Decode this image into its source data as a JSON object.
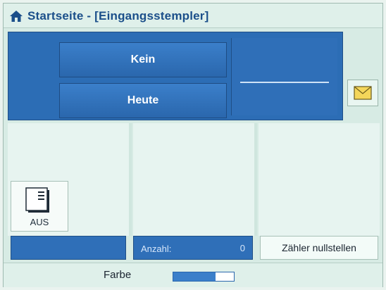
{
  "window": {
    "title": "Startseite - [Eingangsstempler]"
  },
  "panel": {
    "kein_label": "Kein",
    "heute_label": "Heute"
  },
  "aus_button": {
    "label": "AUS"
  },
  "bottom": {
    "anzahl_label": "Anzahl:",
    "anzahl_value": "0",
    "reset_label": "Zähler nullstellen"
  },
  "farbe": {
    "label": "Farbe",
    "level": 0.7
  },
  "colors": {
    "accent": "#2f6fb8",
    "title": "#1b4f8a",
    "background": "#d7ebe4"
  },
  "icons": [
    "home-icon",
    "mail-icon",
    "document-icon"
  ]
}
